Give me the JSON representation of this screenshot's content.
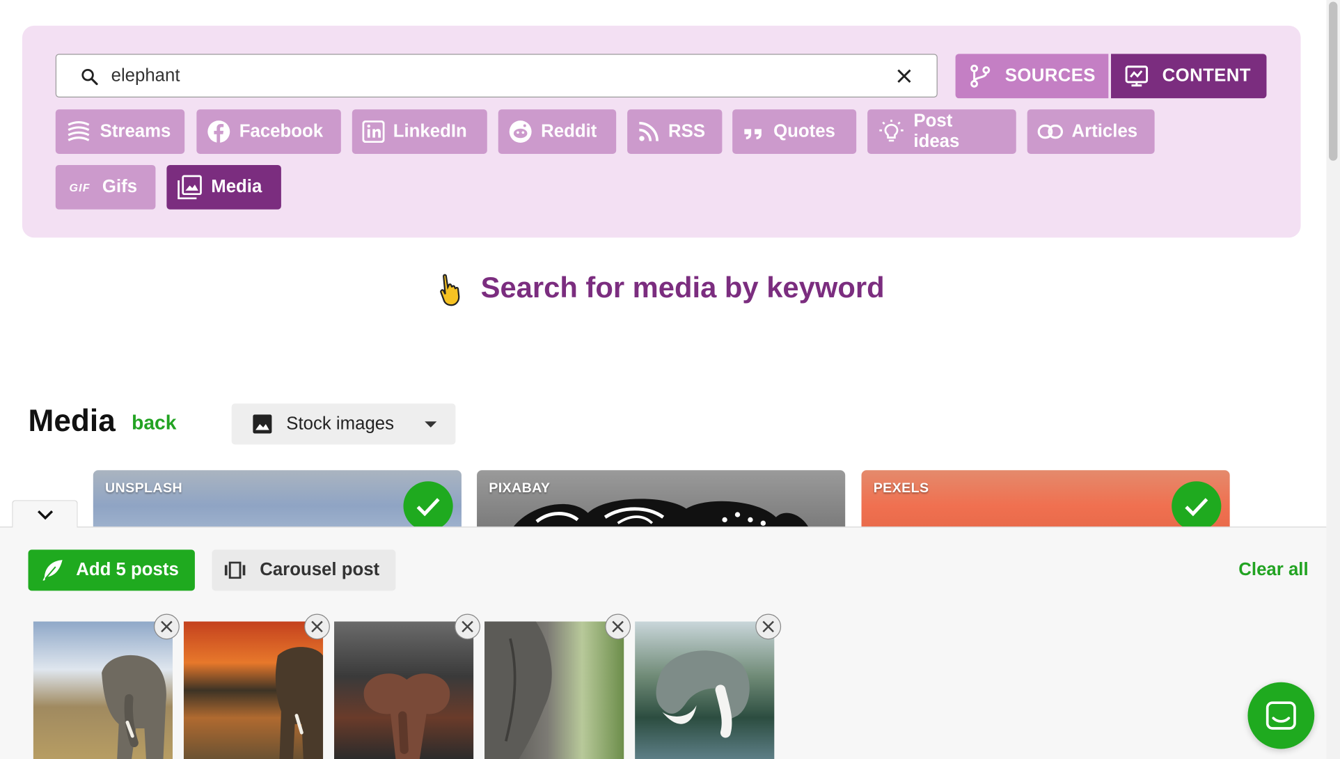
{
  "search": {
    "value": "elephant",
    "placeholder": ""
  },
  "segments": {
    "sources": "SOURCES",
    "content": "CONTENT"
  },
  "chips": [
    {
      "label": "Streams",
      "icon": "streams-icon"
    },
    {
      "label": "Facebook",
      "icon": "facebook-icon"
    },
    {
      "label": "LinkedIn",
      "icon": "linkedin-icon"
    },
    {
      "label": "Reddit",
      "icon": "reddit-icon"
    },
    {
      "label": "RSS",
      "icon": "rss-icon"
    },
    {
      "label": "Quotes",
      "icon": "quotes-icon"
    },
    {
      "label": "Post ideas",
      "icon": "lightbulb-icon"
    },
    {
      "label": "Articles",
      "icon": "link-icon"
    },
    {
      "label": "Gifs",
      "icon": "gif-icon",
      "icon_text": "GIF"
    },
    {
      "label": "Media",
      "icon": "image-icon",
      "active": true
    }
  ],
  "hint": {
    "text": "Search for media by keyword"
  },
  "media": {
    "title": "Media",
    "back": "back",
    "dropdown": "Stock images"
  },
  "sources": [
    {
      "label": "UNSPLASH",
      "selected": true
    },
    {
      "label": "PIXABAY",
      "selected": false
    },
    {
      "label": "PEXELS",
      "selected": true
    }
  ],
  "tray": {
    "add_button": "Add 5 posts",
    "carousel_button": "Carousel post",
    "clear_all": "Clear all"
  },
  "colors": {
    "brand": "#7b2d7f",
    "chip": "#cc9acc",
    "panel": "#f3e0f3",
    "accent_green": "#1faa1f"
  }
}
